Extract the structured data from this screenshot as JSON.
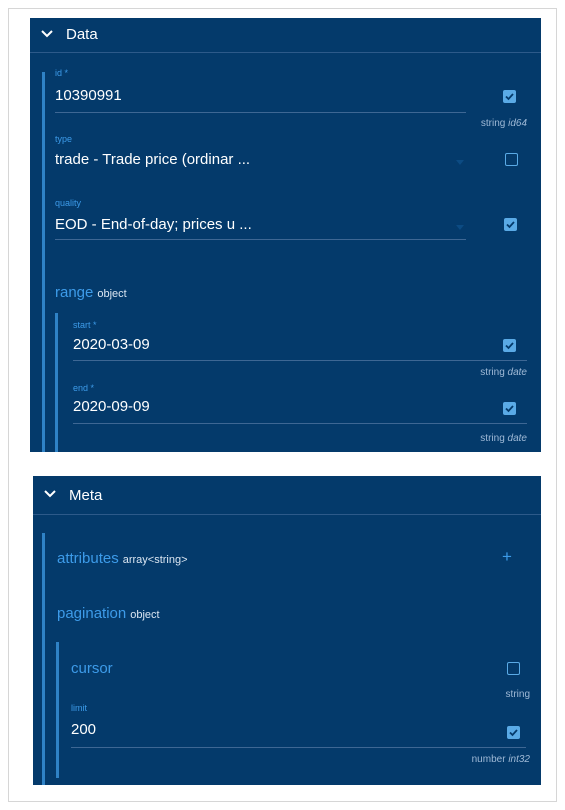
{
  "data_panel": {
    "title": "Data",
    "id": {
      "label": "id *",
      "value": "10390991",
      "hint_type": "string",
      "hint_format": "id64",
      "checked": true
    },
    "type": {
      "label": "type",
      "value": "trade - Trade price (ordinar ...",
      "checked": false
    },
    "quality": {
      "label": "quality",
      "value": "EOD - End-of-day; prices u ...",
      "checked": true
    },
    "range": {
      "name": "range",
      "kind": "object",
      "start": {
        "label": "start *",
        "value": "2020-03-09",
        "hint_type": "string",
        "hint_format": "date",
        "checked": true
      },
      "end": {
        "label": "end *",
        "value": "2020-09-09",
        "hint_type": "string",
        "hint_format": "date",
        "checked": true
      }
    }
  },
  "meta_panel": {
    "title": "Meta",
    "attributes": {
      "name": "attributes",
      "kind": "array<string>",
      "add_icon": "+"
    },
    "pagination": {
      "name": "pagination",
      "kind": "object",
      "cursor": {
        "label": "cursor",
        "hint_type": "string",
        "checked": false
      },
      "limit": {
        "label": "limit",
        "value": "200",
        "hint_type": "number",
        "hint_format": "int32",
        "checked": true
      }
    }
  },
  "colors": {
    "panel_bg": "#043a6b",
    "accent": "#3d9be9",
    "checkbox": "#5aaae6"
  }
}
